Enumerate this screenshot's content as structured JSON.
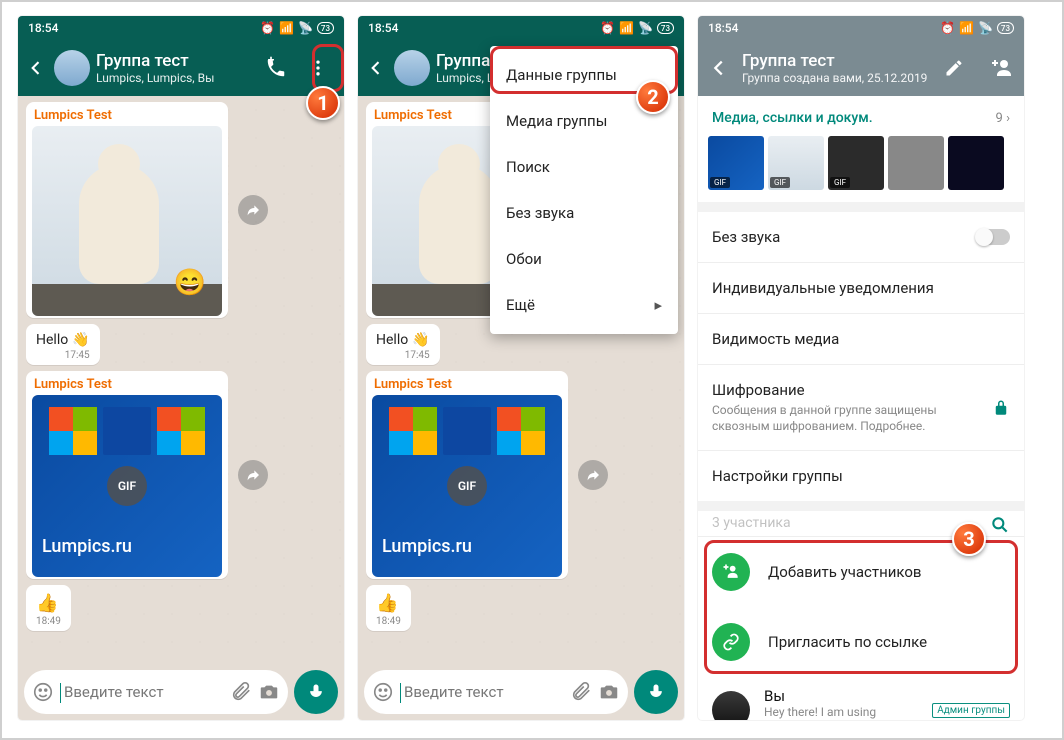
{
  "status": {
    "time": "18:54",
    "battery": "73"
  },
  "chat": {
    "title": "Группа тест",
    "subtitle_full": "Lumpics, Lumpics, Вы",
    "subtitle_clip": "Lumpics, Lumpics, В",
    "sender": "Lumpics Test",
    "gif": "GIF",
    "hello": "Hello",
    "time1": "17:45",
    "time2": "18:49",
    "watermark": "Lumpics.ru",
    "input_placeholder": "Введите текст"
  },
  "menu": {
    "group_data": "Данные группы",
    "media": "Медиа группы",
    "search": "Поиск",
    "mute": "Без звука",
    "wallpaper": "Обои",
    "more": "Ещё"
  },
  "info": {
    "title": "Группа тест",
    "subtitle": "Группа создана вами, 25.12.2019",
    "media_label": "Медиа, ссылки и докум.",
    "media_count": "9",
    "mute": "Без звука",
    "custom_notif": "Индивидуальные уведомления",
    "media_vis": "Видимость медиа",
    "encryption": "Шифрование",
    "encryption_descr": "Сообщения в данной группе защищены сквозным шифрованием. Подробнее.",
    "group_settings": "Настройки группы",
    "participants": "3 участника",
    "add": "Добавить участников",
    "invite": "Пригласить по ссылке",
    "you": "Вы",
    "you_status": "Hey there! I am using WhatsApp.",
    "admin": "Админ группы"
  },
  "marker": {
    "m1": "1",
    "m2": "2",
    "m3": "3"
  }
}
